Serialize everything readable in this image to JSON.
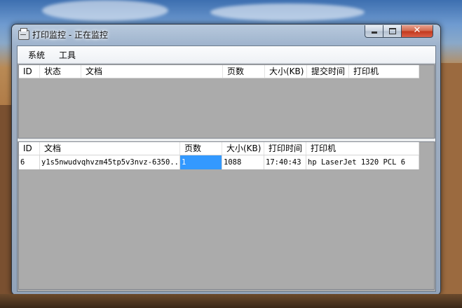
{
  "window": {
    "title": "打印监控 - 正在监控"
  },
  "menu": {
    "items": [
      "系统",
      "工具"
    ]
  },
  "queue_list": {
    "columns": [
      "ID",
      "状态",
      "文档",
      "页数",
      "大小(KB)",
      "提交时间",
      "打印机"
    ]
  },
  "history_list": {
    "columns": [
      "ID",
      "文档",
      "页数",
      "大小(KB)",
      "打印时间",
      "打印机"
    ],
    "rows": [
      [
        "6",
        "y1s5nwudvqhvzm45tp5v3nvz-6350...",
        "1",
        "1088",
        "17:40:43",
        "hp LaserJet 1320 PCL 6"
      ]
    ]
  },
  "window_controls": {
    "close_glyph": "✕"
  }
}
